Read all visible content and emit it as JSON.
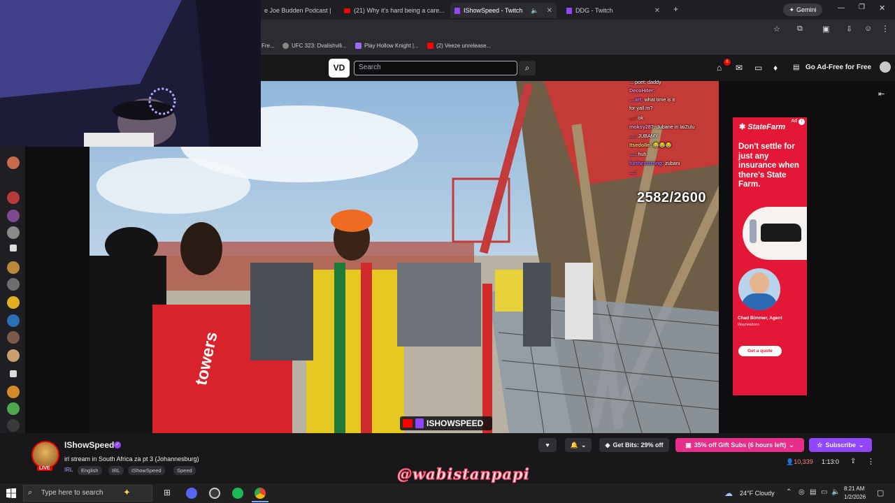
{
  "browser": {
    "tabs": [
      {
        "label": "e Joe Budden Podcast | ",
        "icon": "twitch-icon",
        "active": false
      },
      {
        "label": "(21) Why it's hard being a care...",
        "icon": "youtube-icon",
        "active": false
      },
      {
        "label": "IShowSpeed - Twitch",
        "icon": "twitch-icon",
        "active": true
      },
      {
        "label": "DDG - Twitch",
        "icon": "twitch-icon",
        "active": false
      }
    ],
    "new_tab_label": "+",
    "gemini_label": "Gemini",
    "bookmarks": [
      {
        "label": "Fre..."
      },
      {
        "label": "UFC 323: Dvalishvili..."
      },
      {
        "label": "Play Hollow Knight |..."
      },
      {
        "label": "(2) Veeze unrelease..."
      }
    ]
  },
  "twitch": {
    "logo_text": "VD",
    "search_placeholder": "Search",
    "notifications_count": "6",
    "ad_free_label": "Go Ad-Free for Free"
  },
  "overlay": {
    "counter": "2582/2600",
    "stream_watermark": "ISHOWSPEED",
    "chat": [
      {
        "user": "...",
        "text": "poet: daddy"
      },
      {
        "user": "DecoHiter:",
        "text": ""
      },
      {
        "user": "....art:",
        "text": "what time is it"
      },
      {
        "user": "",
        "text": "for yall rn?"
      },
      {
        "user": "....:",
        "text": "ok"
      },
      {
        "user": "moksy287:",
        "text": "Jubane in laiZulu"
      },
      {
        "user": "....:",
        "text": "JUBAMY"
      },
      {
        "user": "Itsedolle:",
        "text": "😂😂😂"
      },
      {
        "user": "....:",
        "text": "huh"
      },
      {
        "user": "furtheststring:",
        "text": "zubani"
      },
      {
        "user": "....:",
        "text": ""
      }
    ]
  },
  "ad": {
    "brand": "StateFarm",
    "tag": "Ad",
    "headline": "Don't settle for just any insurance when there's State Farm.",
    "agent_name": "Chad Bimmer, Agent",
    "agent_location": "Waynesboro",
    "cta": "Get a quote"
  },
  "channel": {
    "name": "IShowSpeed",
    "live_label": "LIVE",
    "title": "irl stream in South Africa za pt 3 (Johannesburg)",
    "game": "IRL",
    "tags": [
      "English",
      "IRL",
      "IShowSpeed",
      "Speed"
    ],
    "viewers": "10,339",
    "uptime": "1:13:0",
    "get_bits_label": "Get Bits: 29% off",
    "gift_subs_label": "35% off Gift Subs (6 hours left)",
    "subscribe_label": "Subscribe",
    "follow_label": "♥",
    "overlay_watermark": "@wabistanpapi"
  },
  "taskbar": {
    "search_placeholder": "Type here to search",
    "weather": "24°F  Cloudy",
    "time": "8:21 AM",
    "date": "1/2/2026"
  },
  "colors": {
    "twitch_purple": "#9147ff",
    "live_red": "#eb0400",
    "ad_red": "#e31837",
    "gift_pink": "#e62e8a"
  }
}
